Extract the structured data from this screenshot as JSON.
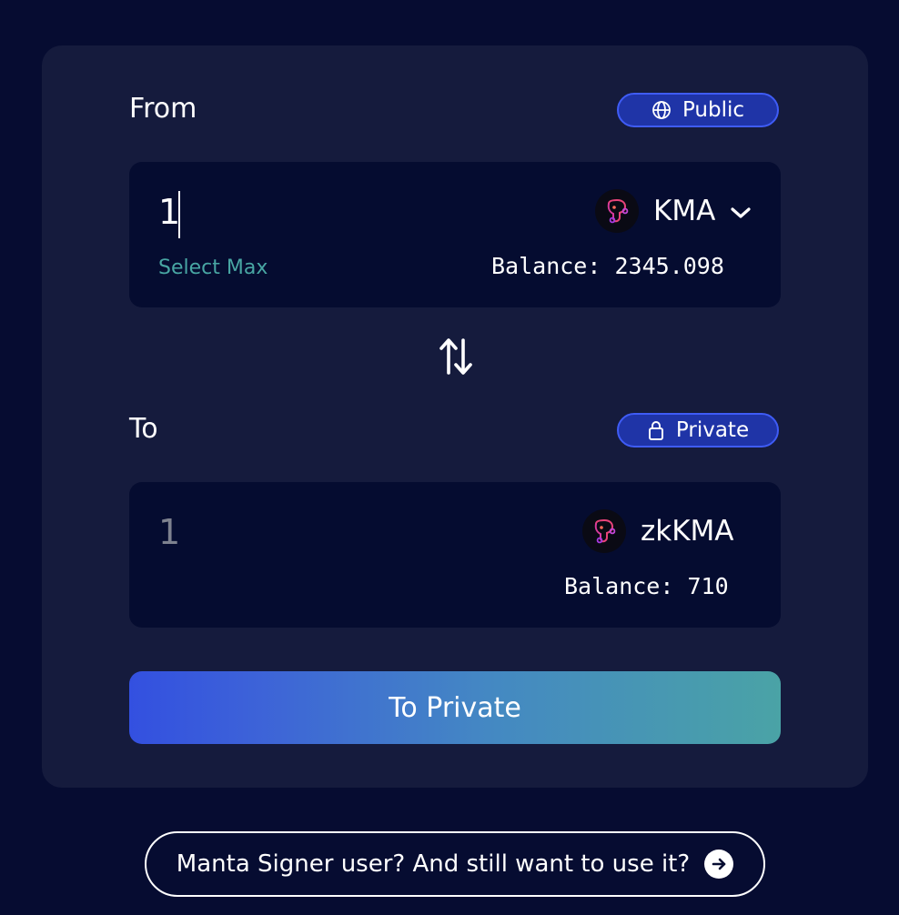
{
  "from": {
    "label": "From",
    "mode": "Public",
    "mode_icon": "globe-icon",
    "amount": "1",
    "select_max": "Select Max",
    "token": "KMA",
    "token_icon": "manta-logo-icon",
    "balance": "Balance: 2345.098"
  },
  "to": {
    "label": "To",
    "mode": "Private",
    "mode_icon": "lock-icon",
    "amount": "1",
    "token": "zkKMA",
    "token_icon": "manta-logo-icon",
    "balance": "Balance: 710"
  },
  "swap_icon": "swap-vertical-arrows-icon",
  "action_button": "To Private",
  "signer_link": "Manta Signer user? And still want to use it?",
  "colors": {
    "background": "#060c31",
    "card": "#151b3d",
    "input_box": "#050c30",
    "pill_fill": "#1f34a7",
    "pill_border": "#3f5cf6",
    "select_max": "#48a6a3",
    "gradient_start": "#3350e0",
    "gradient_end": "#4aa3a6"
  }
}
